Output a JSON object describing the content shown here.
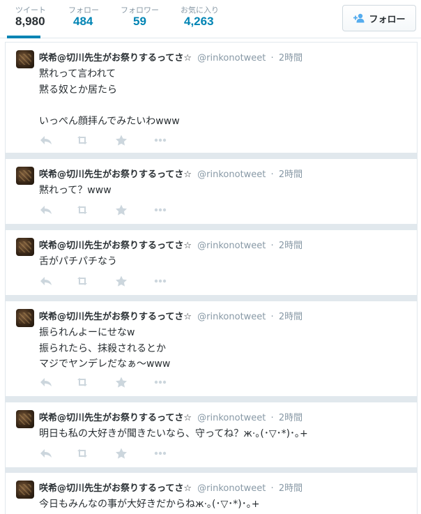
{
  "stats": {
    "tweets": {
      "label": "ツイート",
      "value": "8,980"
    },
    "following": {
      "label": "フォロー",
      "value": "484"
    },
    "followers": {
      "label": "フォロワー",
      "value": "59"
    },
    "favorites": {
      "label": "お気に入り",
      "value": "4,263"
    }
  },
  "follow_button": {
    "label": "フォロー"
  },
  "colors": {
    "accent": "#0084b4",
    "muted": "#8899a6",
    "text": "#292f33",
    "icon": "#ccd6dd"
  },
  "tweets": [
    {
      "name": "咲希@切川先生がお祭りするってさ☆",
      "handle": "@rinkonotweet",
      "separator": "·",
      "time": "2時間",
      "lines": [
        "黙れって言われて",
        "黙る奴とか居たら",
        "",
        "いっぺん顔拝んでみたいわwww"
      ]
    },
    {
      "name": "咲希@切川先生がお祭りするってさ☆",
      "handle": "@rinkonotweet",
      "separator": "·",
      "time": "2時間",
      "lines": [
        "黙れって？www"
      ]
    },
    {
      "name": "咲希@切川先生がお祭りするってさ☆",
      "handle": "@rinkonotweet",
      "separator": "·",
      "time": "2時間",
      "lines": [
        "舌がパチパチなう"
      ]
    },
    {
      "name": "咲希@切川先生がお祭りするってさ☆",
      "handle": "@rinkonotweet",
      "separator": "·",
      "time": "2時間",
      "lines": [
        "振られんよーにせなw",
        "振られたら、抹殺されるとか",
        "マジでヤンデレだなぁ〜www"
      ]
    },
    {
      "name": "咲希@切川先生がお祭りするってさ☆",
      "handle": "@rinkonotweet",
      "separator": "·",
      "time": "2時間",
      "lines": [
        "明日も私の大好きが聞きたいなら、守ってね？ж·｡(･▽･*)･｡+"
      ]
    },
    {
      "name": "咲希@切川先生がお祭りするってさ☆",
      "handle": "@rinkonotweet",
      "separator": "·",
      "time": "2時間",
      "lines": [
        "今日もみんなの事が大好きだからねж·｡(･▽･*)･｡+"
      ]
    }
  ],
  "action_icons": [
    "reply-icon",
    "retweet-icon",
    "favorite-icon",
    "more-icon"
  ]
}
